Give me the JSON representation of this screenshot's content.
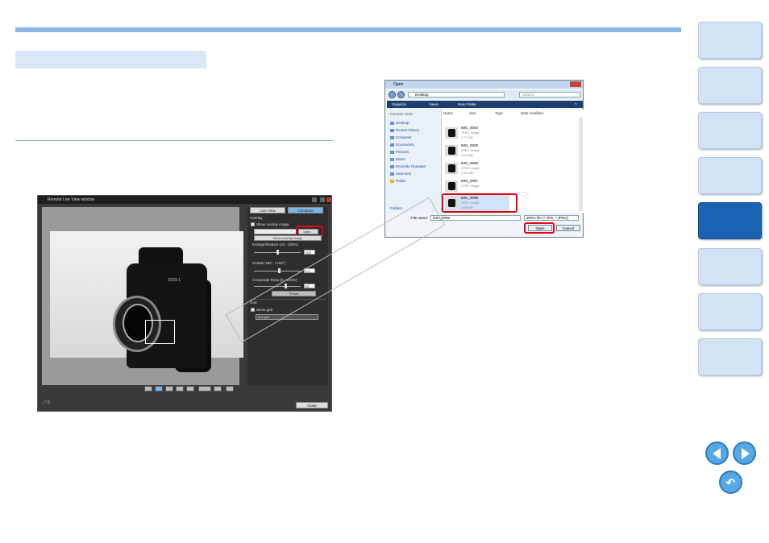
{
  "live_view_window": {
    "title": "Remote Live View window",
    "tabs": [
      "Live View",
      "Compose"
    ],
    "overlay_heading": "Overlay",
    "show_overlay_label": "Show overlay image",
    "open_button": "open...",
    "move_overlay_label": "Move overlay image",
    "enlarge_label": "Enlarge/Reduce (25 - 200%)",
    "enlarge_value": "100",
    "rotate_label": "Rotate(-180 - +180°)",
    "rotate_value": "0.0",
    "composite_label": "Composite Ratio (0 - 100%)",
    "composite_value": "65",
    "preset_label": "Preset",
    "grid_heading": "Grid",
    "show_grid_label": "Show grid",
    "grid_select": "3x3 grid",
    "close_button": "Close",
    "camera_label": "EOS-1"
  },
  "open_dialog": {
    "title": "Open",
    "address": "Desktop",
    "search_placeholder": "Search",
    "toolbar": [
      "Organize",
      "Views",
      "New Folder"
    ],
    "favorite_links_heading": "Favorite Links",
    "favorites": [
      "Desktop",
      "Recent Places",
      "Computer",
      "Documents",
      "Pictures",
      "Music",
      "Recently Changed",
      "Searches",
      "Public"
    ],
    "folders_label": "Folders",
    "columns": [
      "Name",
      "Size",
      "Type",
      "Date modified"
    ],
    "files": [
      {
        "name": "IMG_0004",
        "type": "JPEG Image",
        "size": "2.77 MB"
      },
      {
        "name": "IMG_0005",
        "type": "JPEG Image",
        "size": "3.04 MB"
      },
      {
        "name": "IMG_0006",
        "type": "JPEG Image",
        "size": "2.52 MB"
      },
      {
        "name": "IMG_0007",
        "type": "JPEG Image",
        "size": ""
      },
      {
        "name": "IMG_0008",
        "type": "JPEG Image",
        "size": "2.55 MB"
      }
    ],
    "file_name_label": "File name:",
    "file_name_value": "IMG_0008",
    "file_type": "JPEG file (*.JPG, *.JPEG)",
    "open_button": "Open",
    "cancel_button": "Cancel"
  },
  "colors": {
    "accent": "#1b64b4",
    "highlight": "#e60012",
    "tab": "#d4e3f4"
  }
}
